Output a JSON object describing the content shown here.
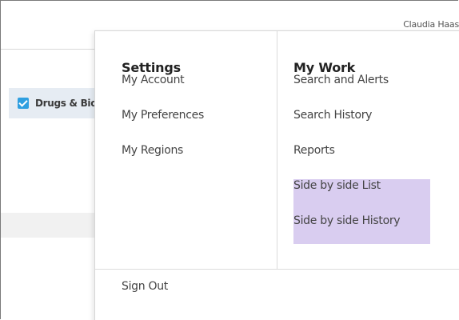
{
  "header": {
    "user_name": "Claudia Haas"
  },
  "filter_chip": {
    "label": "Drugs & Bio",
    "checked": true,
    "checkbox_color": "#2f9fe0"
  },
  "menu": {
    "settings": {
      "heading": "Settings",
      "items": [
        "My Account",
        "My Preferences",
        "My Regions"
      ]
    },
    "my_work": {
      "heading": "My Work",
      "items": [
        "Search and Alerts",
        "Search History",
        "Reports",
        "Side by side List",
        "Side by side History"
      ]
    },
    "sign_out_label": "Sign Out",
    "highlight_color": "#d9cdf0"
  }
}
